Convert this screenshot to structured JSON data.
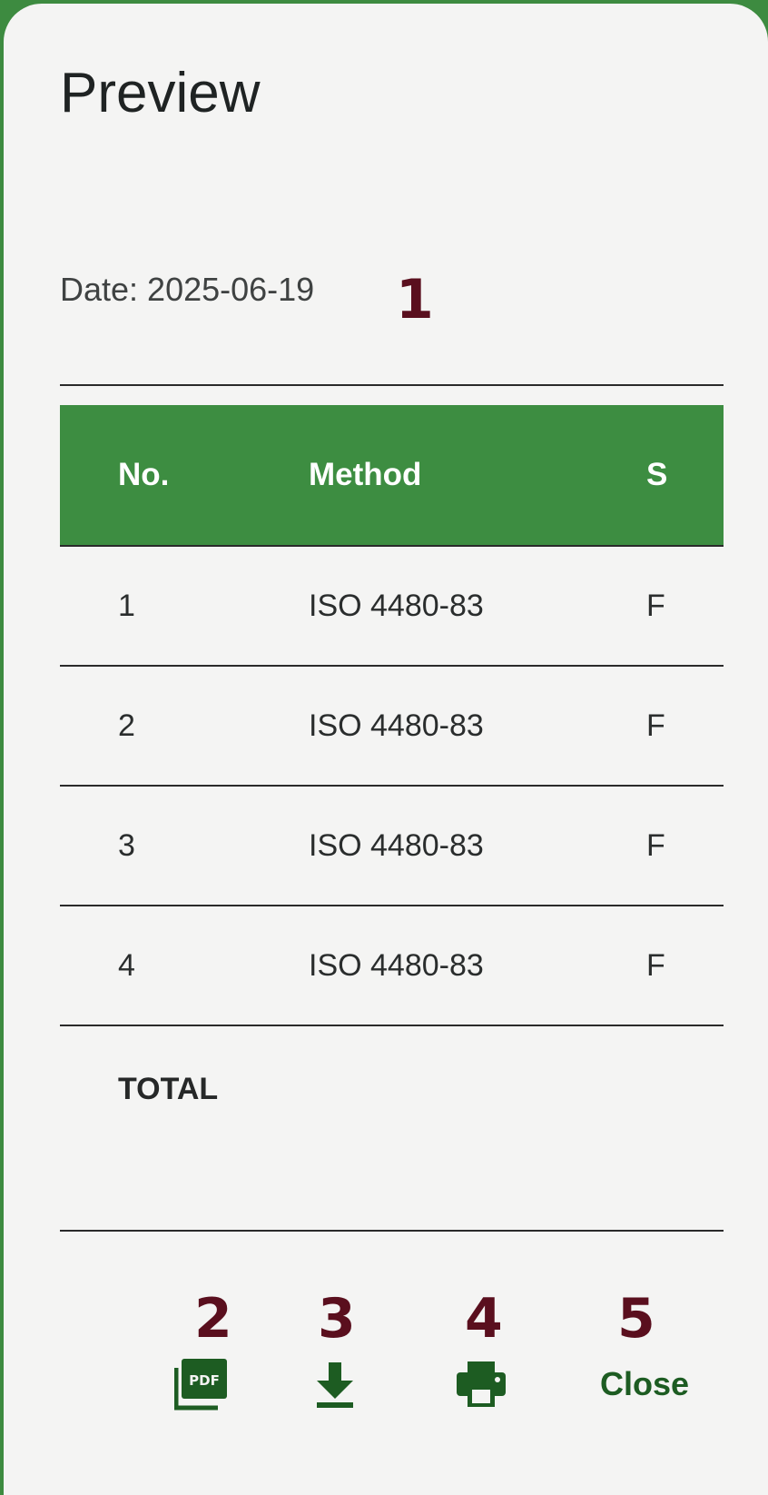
{
  "dialog": {
    "title": "Preview",
    "date_text": "Date: 2025-06-19"
  },
  "table": {
    "headers": [
      "No.",
      "Method",
      "S"
    ],
    "rows": [
      {
        "no": "1",
        "method": "ISO 4480-83",
        "third": "F"
      },
      {
        "no": "2",
        "method": "ISO 4480-83",
        "third": "F"
      },
      {
        "no": "3",
        "method": "ISO 4480-83",
        "third": "F"
      },
      {
        "no": "4",
        "method": "ISO 4480-83",
        "third": "F"
      }
    ],
    "total_label": "TOTAL"
  },
  "actions": {
    "pdf_icon": "pdf-icon",
    "download_icon": "download-icon",
    "print_icon": "print-icon",
    "close_label": "Close"
  },
  "markers": [
    "1",
    "2",
    "3",
    "4",
    "5"
  ],
  "colors": {
    "header_green": "#3d8d41",
    "action_green": "#1d5c22",
    "marker": "#5a0f1e",
    "background": "#f4f4f3"
  }
}
